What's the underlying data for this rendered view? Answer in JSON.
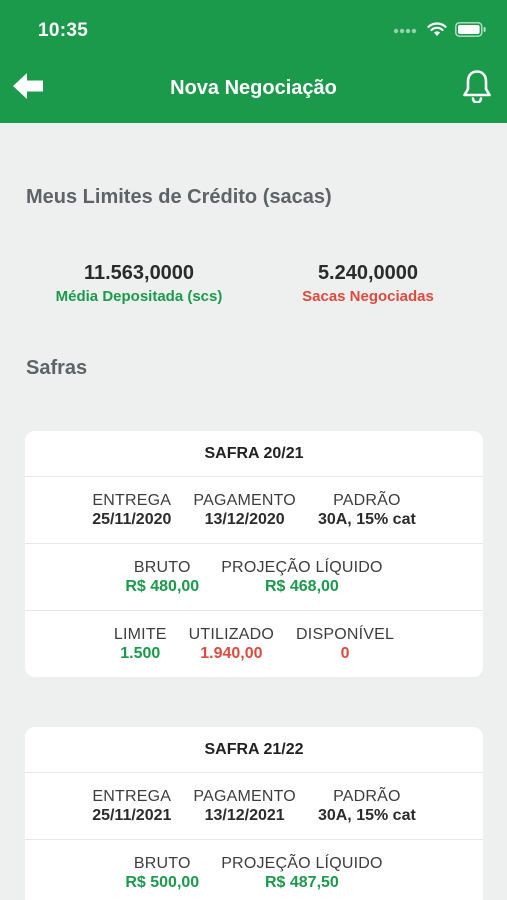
{
  "status_bar": {
    "time": "10:35"
  },
  "nav": {
    "title": "Nova Negociação",
    "back_icon": "arrow-left-icon",
    "bell_icon": "bell-icon"
  },
  "limits": {
    "title": "Meus Limites de Crédito (sacas)",
    "left_value": "11.563,0000",
    "left_label": "Média Depositada (scs)",
    "right_value": "5.240,0000",
    "right_label": "Sacas Negociadas"
  },
  "safras": {
    "title": "Safras",
    "cards": [
      {
        "title": "SAFRA 20/21",
        "entrega_label": "ENTREGA",
        "entrega": "25/11/2020",
        "pagamento_label": "PAGAMENTO",
        "pagamento": "13/12/2020",
        "padrao_label": "PADRÃO",
        "padrao": "30A, 15% cat",
        "bruto_label": "BRUTO",
        "bruto": "R$ 480,00",
        "projecao_label": "PROJEÇÃO LÍQUIDO",
        "projecao": "R$ 468,00",
        "limite_label": "LIMITE",
        "limite": "1.500",
        "utilizado_label": "UTILIZADO",
        "utilizado": "1.940,00",
        "disponivel_label": "DISPONÍVEL",
        "disponivel": "0"
      },
      {
        "title": "SAFRA 21/22",
        "entrega_label": "ENTREGA",
        "entrega": "25/11/2021",
        "pagamento_label": "PAGAMENTO",
        "pagamento": "13/12/2021",
        "padrao_label": "PADRÃO",
        "padrao": "30A, 15% cat",
        "bruto_label": "BRUTO",
        "bruto": "R$ 500,00",
        "projecao_label": "PROJEÇÃO LÍQUIDO",
        "projecao": "R$ 487,50"
      }
    ]
  },
  "colors": {
    "brand_green": "#1b9a4b",
    "alert_red": "#dc4b3e",
    "background": "#eef0f0"
  }
}
